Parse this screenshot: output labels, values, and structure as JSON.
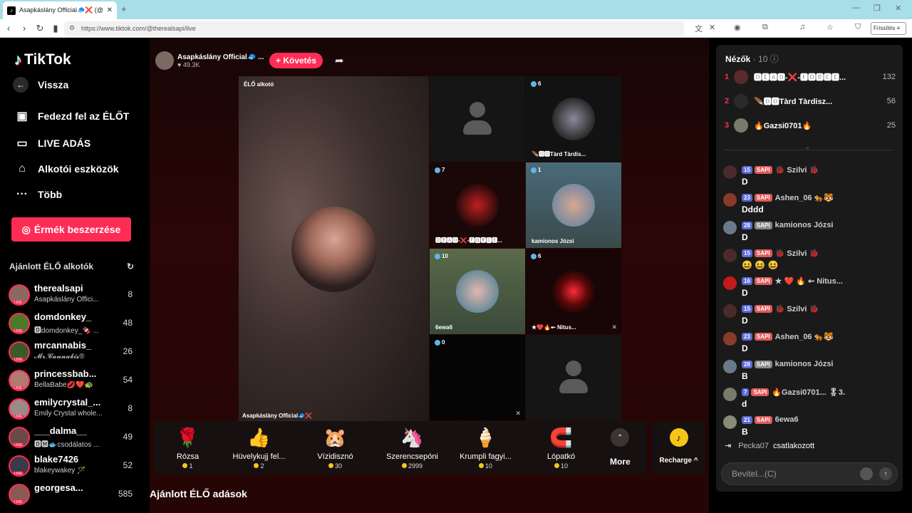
{
  "browser": {
    "tab_title": "Asapkáslány Official🧢❌ (@",
    "tab_close": "✕",
    "new_tab": "+",
    "url": "https://www.tiktok.com/@therealsapi/live",
    "refresh_label": "Frissítés"
  },
  "sidebar": {
    "logo": "TikTok",
    "back_label": "Vissza",
    "menu": [
      {
        "label": "Fedezd fel az ÉLŐT",
        "icon": "calendar-icon"
      },
      {
        "label": "LIVE ADÁS",
        "icon": "camera-icon"
      },
      {
        "label": "Alkotói eszközök",
        "icon": "house-play-icon"
      },
      {
        "label": "Több",
        "icon": "more-icon"
      }
    ],
    "coins_button": "Érmék beszerzése",
    "recommended_title": "Ajánlott ÉLŐ alkotók",
    "live_badge": "LIVE",
    "creators": [
      {
        "name": "therealsapi",
        "sub": "Asapkáslány Offici...",
        "count": "8"
      },
      {
        "name": "domdonkey_",
        "sub": "🅳domdonkey_🍫 ...",
        "count": "48"
      },
      {
        "name": "mrcannabis_",
        "sub": "𝓜𝓻.𝓒𝓪𝓷𝓷𝓪𝓫𝓲𝓼®",
        "count": "26"
      },
      {
        "name": "princessbab...",
        "sub": "BellaBabe💋❤️🐢",
        "count": "54"
      },
      {
        "name": "emilycrystal_...",
        "sub": "Emily Crystal whole...",
        "count": "8"
      },
      {
        "name": "___dalma__",
        "sub": "🅳🅼🐟csodálatos ...",
        "count": "49"
      },
      {
        "name": "blake7426",
        "sub": "blakeywakey 🪄",
        "count": "52"
      },
      {
        "name": "georgesa...",
        "sub": "",
        "count": "585"
      }
    ]
  },
  "stage": {
    "host_name": "Asapkáslány Official🧢 ...",
    "host_likes": "♥ 49.3K",
    "follow_label": "+ Követés",
    "main_label": "ÉLŐ alkotó",
    "main_name": "Asapkáslány Official🧢❌",
    "tiles": [
      {
        "count": "",
        "name": ""
      },
      {
        "count": "6",
        "name": "🪶🅳🅳Tàrd Tàrdis..."
      },
      {
        "count": "7",
        "name": "🅳🅴🅰🅳-❌-🅵🅾🆁🅲🅴..."
      },
      {
        "count": "1",
        "name": "kamionos Józsi"
      },
      {
        "count": "10",
        "name": "6ewa6"
      },
      {
        "count": "6",
        "name": "★❤️🔥⇜ Nitus..."
      },
      {
        "count": "0",
        "name": ""
      },
      {
        "count": "",
        "name": ""
      }
    ],
    "gifts": [
      {
        "name": "Rózsa",
        "price": "1",
        "icon": "🌹"
      },
      {
        "name": "Hüvelykujj fel...",
        "price": "2",
        "icon": "👍"
      },
      {
        "name": "Vízidisznó",
        "price": "30",
        "icon": "🐹"
      },
      {
        "name": "Szerencsepóni",
        "price": "2999",
        "icon": "🦄"
      },
      {
        "name": "Krumpli fagyi...",
        "price": "10",
        "icon": "🍦"
      },
      {
        "name": "Lópatkó",
        "price": "10",
        "icon": "🧲"
      }
    ],
    "more_label": "More",
    "recharge_label": "Recharge ^",
    "recommended_live": "Ajánlott ÉLŐ adások"
  },
  "chat": {
    "viewers_label": "Nézők",
    "viewers_count": "· 10",
    "top_viewers": [
      {
        "rank": "1",
        "name": "🅳🅴🅰🅳-❌-🅵🅾🆁🅲🅴...",
        "score": "132"
      },
      {
        "rank": "2",
        "name": "🪶🅳🅳Tàrd Tàrdisz...",
        "score": "56"
      },
      {
        "rank": "3",
        "name": "🔥Gazsi0701🔥",
        "score": "25"
      }
    ],
    "messages": [
      {
        "level": "15",
        "fan": "SAPI",
        "user": "🐞 Szilvi 🐞",
        "text": "D"
      },
      {
        "level": "23",
        "fan": "SAPI",
        "user": "Ashen_06 🐅🐯",
        "text": "Dddd"
      },
      {
        "level": "28",
        "fan": "SAPI",
        "user": "kamionos Józsi",
        "text": "D"
      },
      {
        "level": "15",
        "fan": "SAPI",
        "user": "🐞 Szilvi 🐞",
        "text": "😆 😆 😆"
      },
      {
        "level": "16",
        "fan": "SAPI",
        "user": "★ ❤️ 🔥 ⇜ Nitus...",
        "text": "D"
      },
      {
        "level": "15",
        "fan": "SAPI",
        "user": "🐞 Szilvi 🐞",
        "text": "D"
      },
      {
        "level": "23",
        "fan": "SAPI",
        "user": "Ashen_06 🐅🐯",
        "text": "D"
      },
      {
        "level": "28",
        "fan": "SAPI",
        "user": "kamionos Józsi",
        "text": "B"
      },
      {
        "level": "7",
        "fan": "SAPI",
        "user": "🔥Gazsi0701... 🎖3.",
        "text": "d"
      },
      {
        "level": "21",
        "fan": "SAPI",
        "user": "6ewa6",
        "text": "B"
      }
    ],
    "joined_user": "Pecka07",
    "joined_text": "csatlakozott",
    "input_placeholder": "Bevitel...(C)"
  },
  "colors": {
    "accent": "#fe2c55",
    "coin": "#f5c518",
    "chat_bg": "#1a1a1a"
  }
}
